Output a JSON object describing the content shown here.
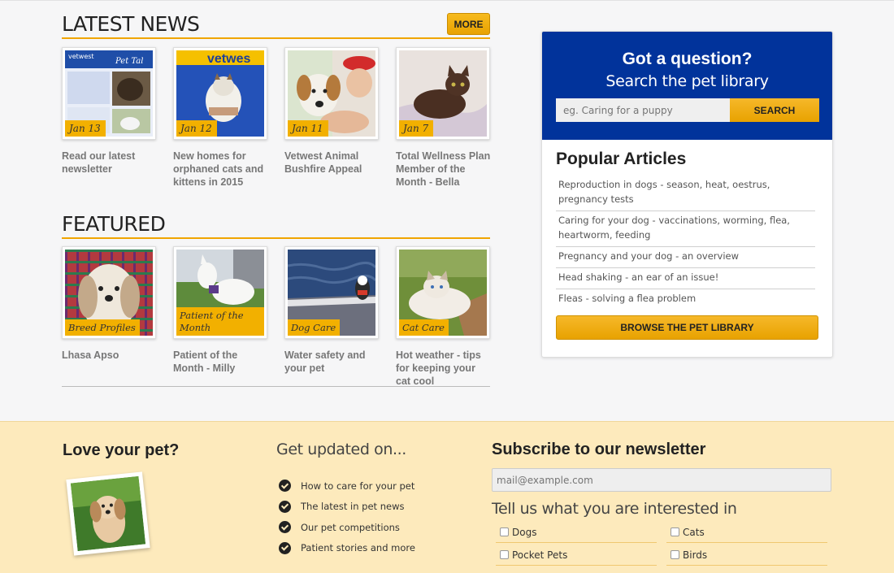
{
  "latest_news": {
    "heading": "LATEST NEWS",
    "more_label": "MORE",
    "items": [
      {
        "date": "Jan 13",
        "title": "Read our latest newsletter",
        "image": "newsletter-cover"
      },
      {
        "date": "Jan 12",
        "title": "New homes for orphaned cats and kittens in 2015",
        "image": "kitten-held-by-staff"
      },
      {
        "date": "Jan 11",
        "title": "Vetwest Animal Bushfire Appeal",
        "image": "dog-with-man"
      },
      {
        "date": "Jan 7",
        "title": "Total Wellness Plan Member of the Month - Bella",
        "image": "brown-cat-on-bed"
      }
    ]
  },
  "featured": {
    "heading": "FEATURED",
    "items": [
      {
        "tag": "Breed Profiles",
        "title": "Lhasa Apso",
        "image": "lhasa-apso-dog"
      },
      {
        "tag": "Patient of the Month",
        "title": "Patient of the Month - Milly",
        "image": "white-bull-terrier"
      },
      {
        "tag": "Dog Care",
        "title": "Water safety and your pet",
        "image": "dog-in-boat"
      },
      {
        "tag": "Cat Care",
        "title": "Hot weather - tips for keeping your cat cool",
        "image": "fluffy-cat-on-deck"
      }
    ]
  },
  "sidebar": {
    "question": "Got a question?",
    "subtitle": "Search the pet library",
    "search_placeholder": "eg. Caring for a puppy",
    "search_label": "SEARCH",
    "popular_title": "Popular Articles",
    "articles": [
      "Reproduction in dogs - season, heat, oestrus, pregnancy tests",
      "Caring for your dog - vaccinations, worming, flea, heartworm, feeding",
      "Pregnancy and your dog - an overview",
      "Head shaking - an ear of an issue!",
      "Fleas - solving a flea problem"
    ],
    "browse_label": "BROWSE THE PET LIBRARY"
  },
  "footer": {
    "love_title": "Love your pet?",
    "updated_title": "Get updated on...",
    "updates": [
      "How to care for your pet",
      "The latest in pet news",
      "Our pet competitions",
      "Patient stories and more"
    ],
    "subscribe_title": "Subscribe to our newsletter",
    "email_placeholder": "mail@example.com",
    "interests_title": "Tell us what you are interested in",
    "interests": [
      "Dogs",
      "Cats",
      "Pocket Pets",
      "Birds"
    ]
  },
  "colors": {
    "accent": "#f2b000",
    "sidebar_blue": "#01339b",
    "footer_bg": "#fdeabc"
  }
}
